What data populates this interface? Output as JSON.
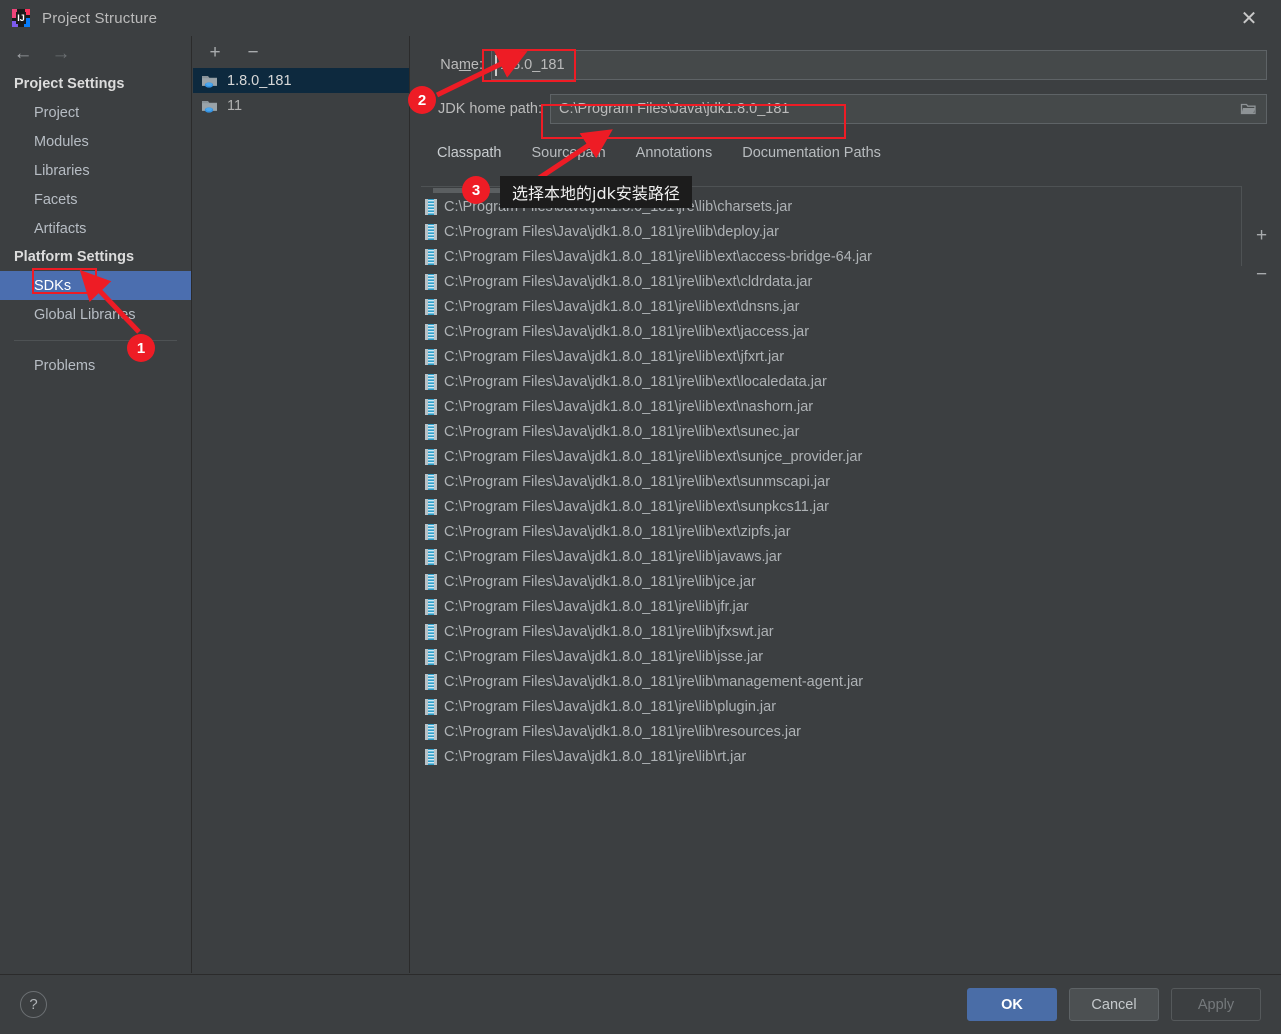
{
  "window": {
    "title": "Project Structure",
    "logo_icon": "intellij-idea-logo",
    "close_icon": "close-icon"
  },
  "sidebar": {
    "back_icon": "arrow-left-icon",
    "forward_icon": "arrow-right-icon",
    "sections": [
      {
        "title": "Project Settings",
        "items": [
          {
            "label": "Project",
            "selected": false
          },
          {
            "label": "Modules",
            "selected": false
          },
          {
            "label": "Libraries",
            "selected": false
          },
          {
            "label": "Facets",
            "selected": false
          },
          {
            "label": "Artifacts",
            "selected": false
          }
        ]
      },
      {
        "title": "Platform Settings",
        "items": [
          {
            "label": "SDKs",
            "selected": true
          },
          {
            "label": "Global Libraries",
            "selected": false
          }
        ]
      }
    ],
    "footer_items": [
      {
        "label": "Problems",
        "selected": false
      }
    ]
  },
  "sdk_list": {
    "add_icon": "plus-icon",
    "remove_icon": "minus-icon",
    "items": [
      {
        "label": "1.8.0_181",
        "icon": "java-sdk-folder-icon",
        "selected": true
      },
      {
        "label": "11",
        "icon": "java-sdk-folder-icon",
        "selected": false
      }
    ]
  },
  "detail": {
    "name_label": "Name:",
    "name_label_pre": "Na",
    "name_label_mnemonic": "m",
    "name_label_post": "e:",
    "name_value": "1.8.0_181",
    "home_path_label": "JDK home path:",
    "home_path_value": "C:\\Program Files\\Java\\jdk1.8.0_181",
    "browse_icon": "folder-browse-icon",
    "tabs": [
      {
        "label": "Classpath",
        "active": true
      },
      {
        "label": "Sourcepath",
        "active": false
      },
      {
        "label": "Annotations",
        "active": false
      },
      {
        "label": "Documentation Paths",
        "active": false
      }
    ],
    "classpath_add_icon": "plus-icon",
    "classpath_remove_icon": "minus-icon",
    "classpath_entries": [
      "C:\\Program Files\\Java\\jdk1.8.0_181\\jre\\lib\\charsets.jar",
      "C:\\Program Files\\Java\\jdk1.8.0_181\\jre\\lib\\deploy.jar",
      "C:\\Program Files\\Java\\jdk1.8.0_181\\jre\\lib\\ext\\access-bridge-64.jar",
      "C:\\Program Files\\Java\\jdk1.8.0_181\\jre\\lib\\ext\\cldrdata.jar",
      "C:\\Program Files\\Java\\jdk1.8.0_181\\jre\\lib\\ext\\dnsns.jar",
      "C:\\Program Files\\Java\\jdk1.8.0_181\\jre\\lib\\ext\\jaccess.jar",
      "C:\\Program Files\\Java\\jdk1.8.0_181\\jre\\lib\\ext\\jfxrt.jar",
      "C:\\Program Files\\Java\\jdk1.8.0_181\\jre\\lib\\ext\\localedata.jar",
      "C:\\Program Files\\Java\\jdk1.8.0_181\\jre\\lib\\ext\\nashorn.jar",
      "C:\\Program Files\\Java\\jdk1.8.0_181\\jre\\lib\\ext\\sunec.jar",
      "C:\\Program Files\\Java\\jdk1.8.0_181\\jre\\lib\\ext\\sunjce_provider.jar",
      "C:\\Program Files\\Java\\jdk1.8.0_181\\jre\\lib\\ext\\sunmscapi.jar",
      "C:\\Program Files\\Java\\jdk1.8.0_181\\jre\\lib\\ext\\sunpkcs11.jar",
      "C:\\Program Files\\Java\\jdk1.8.0_181\\jre\\lib\\ext\\zipfs.jar",
      "C:\\Program Files\\Java\\jdk1.8.0_181\\jre\\lib\\javaws.jar",
      "C:\\Program Files\\Java\\jdk1.8.0_181\\jre\\lib\\jce.jar",
      "C:\\Program Files\\Java\\jdk1.8.0_181\\jre\\lib\\jfr.jar",
      "C:\\Program Files\\Java\\jdk1.8.0_181\\jre\\lib\\jfxswt.jar",
      "C:\\Program Files\\Java\\jdk1.8.0_181\\jre\\lib\\jsse.jar",
      "C:\\Program Files\\Java\\jdk1.8.0_181\\jre\\lib\\management-agent.jar",
      "C:\\Program Files\\Java\\jdk1.8.0_181\\jre\\lib\\plugin.jar",
      "C:\\Program Files\\Java\\jdk1.8.0_181\\jre\\lib\\resources.jar",
      "C:\\Program Files\\Java\\jdk1.8.0_181\\jre\\lib\\rt.jar"
    ]
  },
  "footer": {
    "help_label": "?",
    "ok_label": "OK",
    "cancel_label": "Cancel",
    "apply_label": "Apply"
  },
  "annotations": {
    "marker_1": "1",
    "marker_2": "2",
    "marker_3": "3",
    "tooltip_text": "选择本地的jdk安装路径",
    "highlight_color": "#ee1c25"
  }
}
